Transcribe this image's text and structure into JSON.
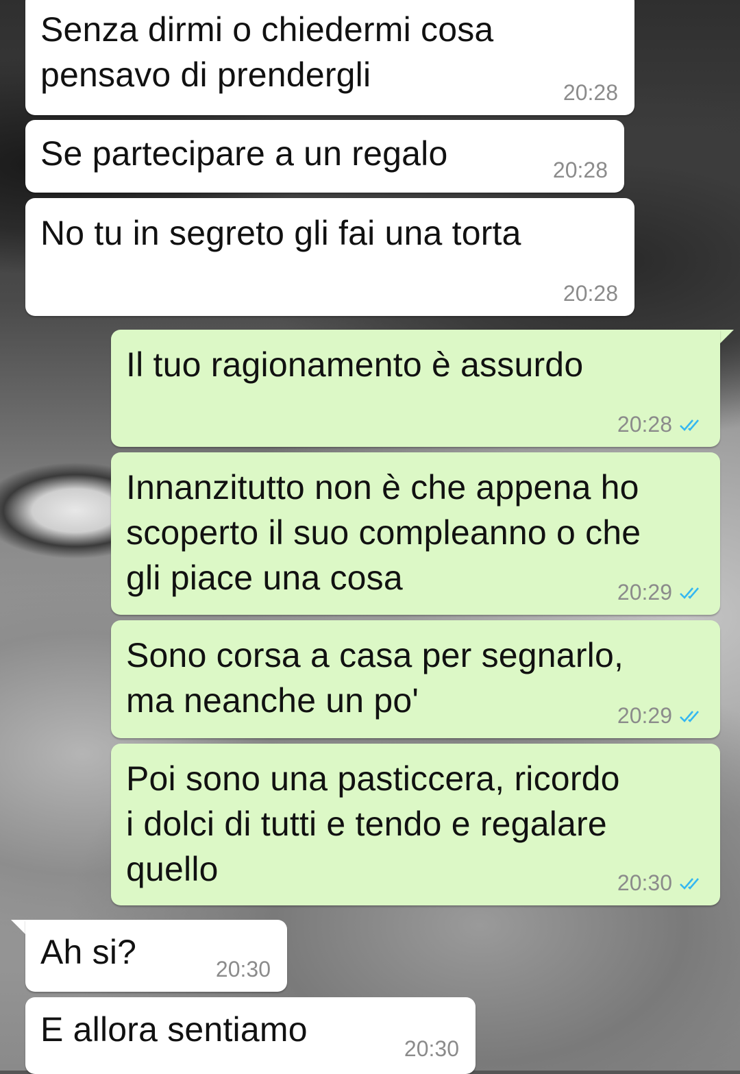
{
  "messages": [
    {
      "direction": "in",
      "text": "Senza dirmi o chiedermi cosa\npensavo di prendergli",
      "time": "20:28"
    },
    {
      "direction": "in",
      "text": "Se partecipare a un regalo",
      "time": "20:28"
    },
    {
      "direction": "in",
      "text": "No tu in segreto gli fai una torta",
      "time": "20:28"
    },
    {
      "direction": "out",
      "text": "Il tuo ragionamento è assurdo",
      "time": "20:28",
      "status": "read"
    },
    {
      "direction": "out",
      "text": "Innanzitutto non è che appena ho\nscoperto il suo compleanno o che\ngli piace una cosa",
      "time": "20:29",
      "status": "read"
    },
    {
      "direction": "out",
      "text": "Sono corsa a casa per segnarlo,\nma neanche un po'",
      "time": "20:29",
      "status": "read"
    },
    {
      "direction": "out",
      "text": "Poi sono una pasticcera, ricordo\ni dolci di tutti e tendo e regalare\nquello",
      "time": "20:30",
      "status": "read"
    },
    {
      "direction": "in",
      "text": "Ah si?",
      "time": "20:30"
    },
    {
      "direction": "in",
      "text": "E allora sentiamo",
      "time": "20:30"
    }
  ],
  "colors": {
    "incoming_bubble": "#ffffff",
    "outgoing_bubble": "#dcf8c6",
    "read_ticks": "#34b7f1",
    "timestamp": "#8b8b8b"
  },
  "icons": {
    "read_status": "double-check-icon"
  }
}
